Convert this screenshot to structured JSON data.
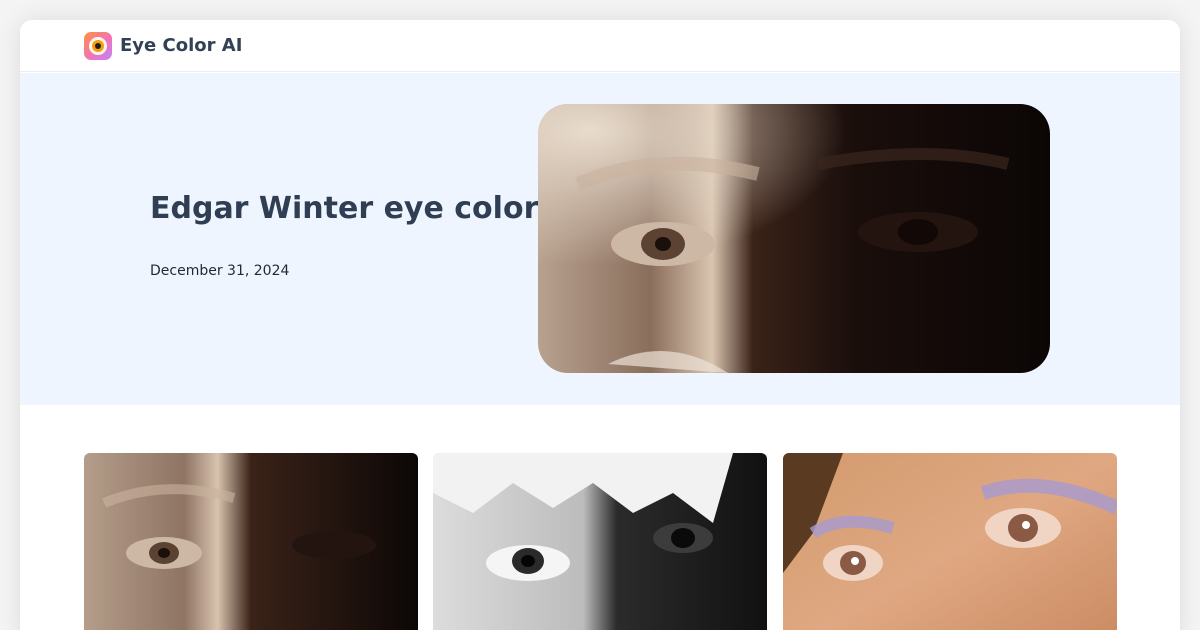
{
  "nav": {
    "brand": "Eye Color AI",
    "logo_icon": "eye-logo-icon"
  },
  "hero": {
    "title": "Edgar Winter eye color",
    "date": "December 31, 2024",
    "image_icon": "eyes-closeup-photo"
  },
  "gallery": {
    "items": [
      {
        "icon": "eyes-closeup-photo-warm"
      },
      {
        "icon": "eyes-closeup-photo-bw"
      },
      {
        "icon": "eyes-closeup-photo-makeup"
      }
    ]
  },
  "colors": {
    "page_bg": "#f4f4f5",
    "hero_bg": "#eef5ff",
    "title": "#2f3e52",
    "text": "#1f2937"
  }
}
